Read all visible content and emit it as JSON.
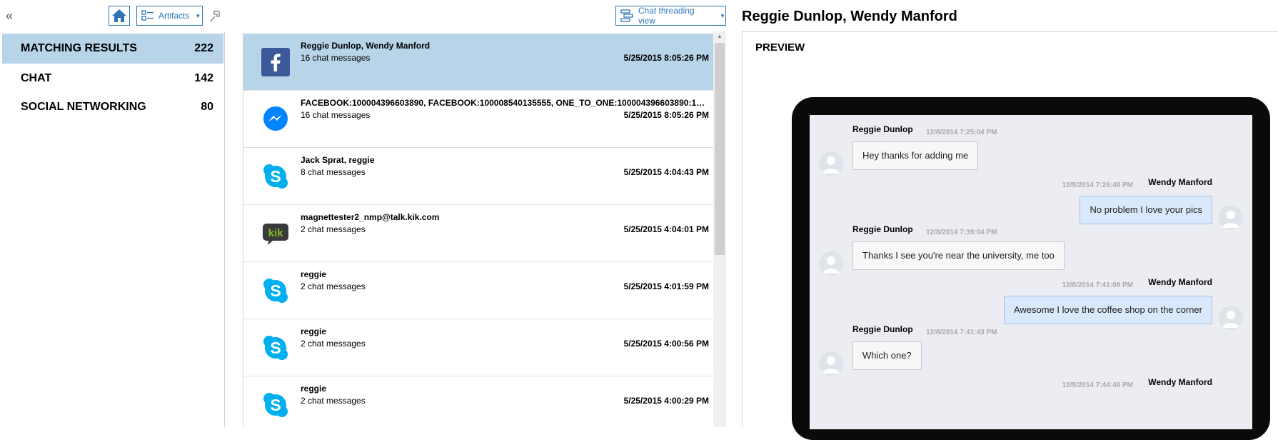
{
  "toolbar": {
    "collapse_glyph": "«",
    "artifacts_label": "Artifacts",
    "threading_label": "Chat threading view",
    "title": "Reggie Dunlop, Wendy Manford"
  },
  "categories": [
    {
      "label": "MATCHING RESULTS",
      "count": "222"
    },
    {
      "label": "CHAT",
      "count": "142"
    },
    {
      "label": "SOCIAL NETWORKING",
      "count": "80"
    }
  ],
  "conversations": [
    {
      "icon": "facebook-icon",
      "title": "Reggie Dunlop, Wendy Manford",
      "subtitle": "16 chat messages",
      "time": "5/25/2015 8:05:26 PM"
    },
    {
      "icon": "messenger-icon",
      "title": "FACEBOOK:100004396603890, FACEBOOK:100008540135555, ONE_TO_ONE:100004396603890:100...",
      "subtitle": "16 chat messages",
      "time": "5/25/2015 8:05:26 PM"
    },
    {
      "icon": "skype-icon",
      "title": "Jack Sprat, reggie",
      "subtitle": "8 chat messages",
      "time": "5/25/2015 4:04:43 PM"
    },
    {
      "icon": "kik-icon",
      "title": "magnettester2_nmp@talk.kik.com",
      "subtitle": "2 chat messages",
      "time": "5/25/2015 4:04:01 PM"
    },
    {
      "icon": "skype-icon",
      "title": "reggie",
      "subtitle": "2 chat messages",
      "time": "5/25/2015 4:01:59 PM"
    },
    {
      "icon": "skype-icon",
      "title": "reggie",
      "subtitle": "2 chat messages",
      "time": "5/25/2015 4:00:56 PM"
    },
    {
      "icon": "skype-icon",
      "title": "reggie",
      "subtitle": "2 chat messages",
      "time": "5/25/2015 4:00:29 PM"
    }
  ],
  "preview": {
    "label": "PREVIEW",
    "messages": [
      {
        "direction": "in",
        "sender": "Reggie Dunlop",
        "time": "12/8/2014 7:25:04 PM",
        "text": "Hey thanks for adding me"
      },
      {
        "direction": "out",
        "sender": "Wendy Manford",
        "time": "12/8/2014 7:26:48 PM",
        "text": "No problem I love your pics"
      },
      {
        "direction": "in",
        "sender": "Reggie Dunlop",
        "time": "12/8/2014 7:39:04 PM",
        "text": "Thanks I see you're near the university, me too"
      },
      {
        "direction": "out",
        "sender": "Wendy Manford",
        "time": "12/8/2014 7:41:08 PM",
        "text": "Awesome I love the coffee shop on the corner"
      },
      {
        "direction": "in",
        "sender": "Reggie Dunlop",
        "time": "12/8/2014 7:41:43 PM",
        "text": "Which one?"
      },
      {
        "direction": "out",
        "sender": "Wendy Manford",
        "time": "12/8/2014 7:44:46 PM",
        "text": ""
      }
    ]
  },
  "colors": {
    "accent": "#2e75b6",
    "selected_row": "#b8d4e8",
    "facebook": "#3b5998",
    "messenger": "#0084ff",
    "skype": "#00aff0",
    "kik": "#82bc23"
  }
}
